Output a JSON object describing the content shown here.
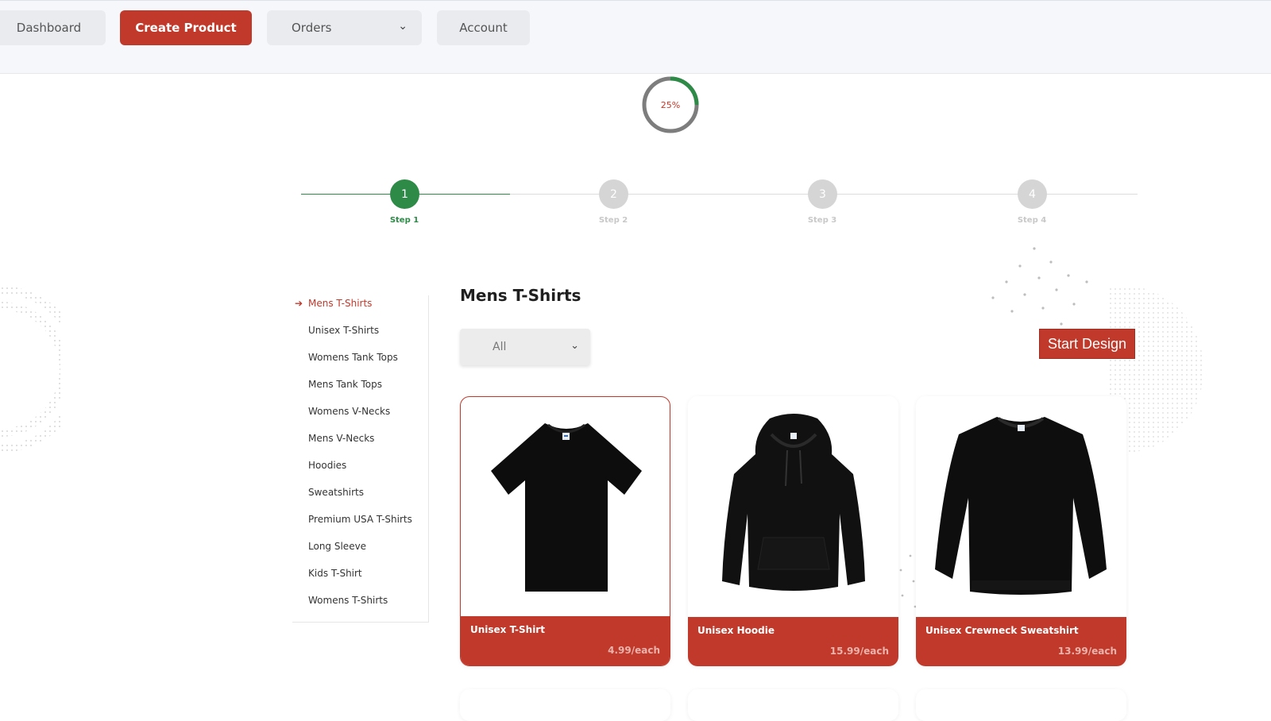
{
  "nav": {
    "dashboard": "Dashboard",
    "create_product": "Create Product",
    "orders": "Orders",
    "account": "Account"
  },
  "progress": {
    "value": 0.25,
    "label": "25%"
  },
  "steps": [
    {
      "num": "1",
      "label": "Step 1",
      "active": true
    },
    {
      "num": "2",
      "label": "Step 2",
      "active": false
    },
    {
      "num": "3",
      "label": "Step 3",
      "active": false
    },
    {
      "num": "4",
      "label": "Step 4",
      "active": false
    }
  ],
  "categories": [
    "Mens T-Shirts",
    "Unisex T-Shirts",
    "Womens Tank Tops",
    "Mens Tank Tops",
    "Womens V-Necks",
    "Mens V-Necks",
    "Hoodies",
    "Sweatshirts",
    "Premium USA T-Shirts",
    "Long Sleeve",
    "Kids T-Shirt",
    "Womens T-Shirts"
  ],
  "active_category": "Mens T-Shirts",
  "main": {
    "title": "Mens T-Shirts",
    "filter_value": "All",
    "start_design": "Start Design"
  },
  "products": [
    {
      "name": "Unisex T-Shirt",
      "price": "4.99/each",
      "icon": "tshirt-image",
      "selected": true
    },
    {
      "name": "Unisex Hoodie",
      "price": "15.99/each",
      "icon": "hoodie-image",
      "selected": false
    },
    {
      "name": "Unisex Crewneck Sweatshirt",
      "price": "13.99/each",
      "icon": "sweatshirt-image",
      "selected": false
    }
  ],
  "colors": {
    "accent": "#c0392b",
    "success": "#2e8b47",
    "muted": "#d5d5d5"
  }
}
